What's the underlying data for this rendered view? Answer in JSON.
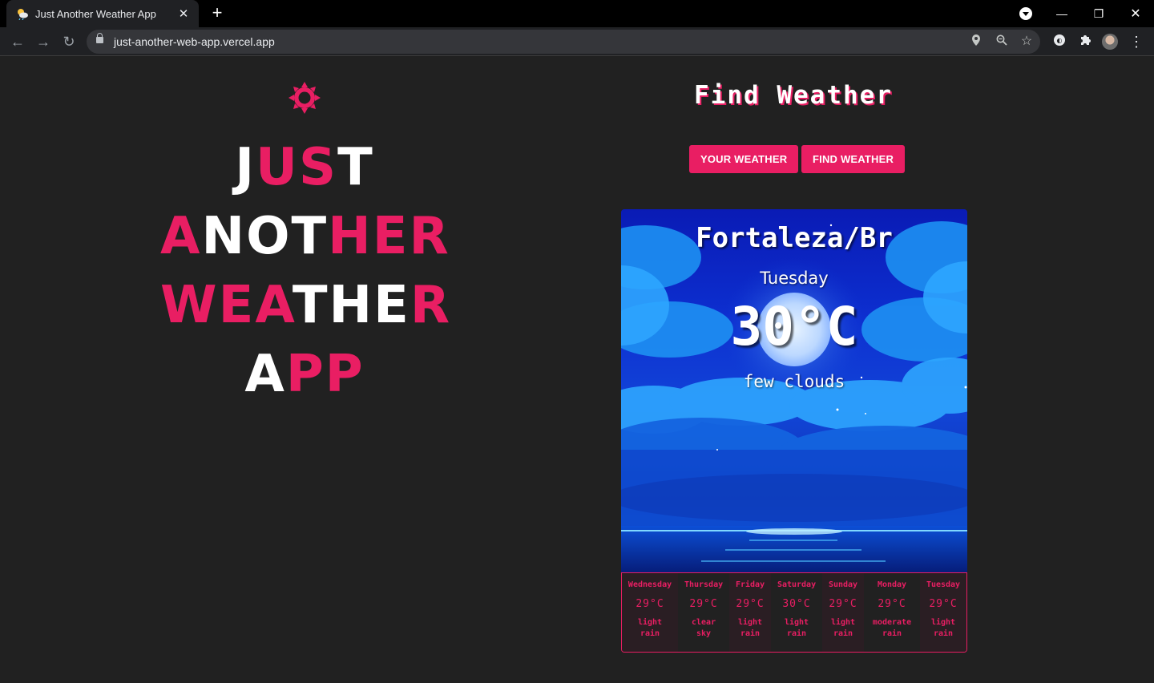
{
  "browser": {
    "tab_title": "Just Another Weather App",
    "url": "just-another-web-app.vercel.app"
  },
  "logo": {
    "lines": [
      {
        "parts": [
          {
            "t": "J",
            "c": "w"
          },
          {
            "t": "US",
            "c": "p"
          },
          {
            "t": "T",
            "c": "w"
          }
        ]
      },
      {
        "parts": [
          {
            "t": "A",
            "c": "p"
          },
          {
            "t": "NOT",
            "c": "w"
          },
          {
            "t": "HER",
            "c": "p"
          }
        ]
      },
      {
        "parts": [
          {
            "t": "WEA",
            "c": "p"
          },
          {
            "t": "THE",
            "c": "w"
          },
          {
            "t": "R",
            "c": "p"
          }
        ]
      },
      {
        "parts": [
          {
            "t": "A",
            "c": "w"
          },
          {
            "t": "PP",
            "c": "p"
          }
        ]
      }
    ]
  },
  "header": {
    "title": "Find Weather",
    "your_weather_label": "YOUR WEATHER",
    "find_weather_label": "FIND WEATHER"
  },
  "current": {
    "city": "Fortaleza/Br",
    "day": "Tuesday",
    "temp": "30°C",
    "description": "few clouds"
  },
  "forecast": [
    {
      "day": "Wednesday",
      "temp": "29°C",
      "desc1": "light",
      "desc2": "rain"
    },
    {
      "day": "Thursday",
      "temp": "29°C",
      "desc1": "clear",
      "desc2": "sky"
    },
    {
      "day": "Friday",
      "temp": "29°C",
      "desc1": "light",
      "desc2": "rain"
    },
    {
      "day": "Saturday",
      "temp": "30°C",
      "desc1": "light",
      "desc2": "rain"
    },
    {
      "day": "Sunday",
      "temp": "29°C",
      "desc1": "light",
      "desc2": "rain"
    },
    {
      "day": "Monday",
      "temp": "29°C",
      "desc1": "moderate",
      "desc2": "rain"
    },
    {
      "day": "Tuesday",
      "temp": "29°C",
      "desc1": "light",
      "desc2": "rain"
    }
  ],
  "colors": {
    "accent": "#e91e63",
    "background": "#212121",
    "text_light": "#ffffff"
  }
}
